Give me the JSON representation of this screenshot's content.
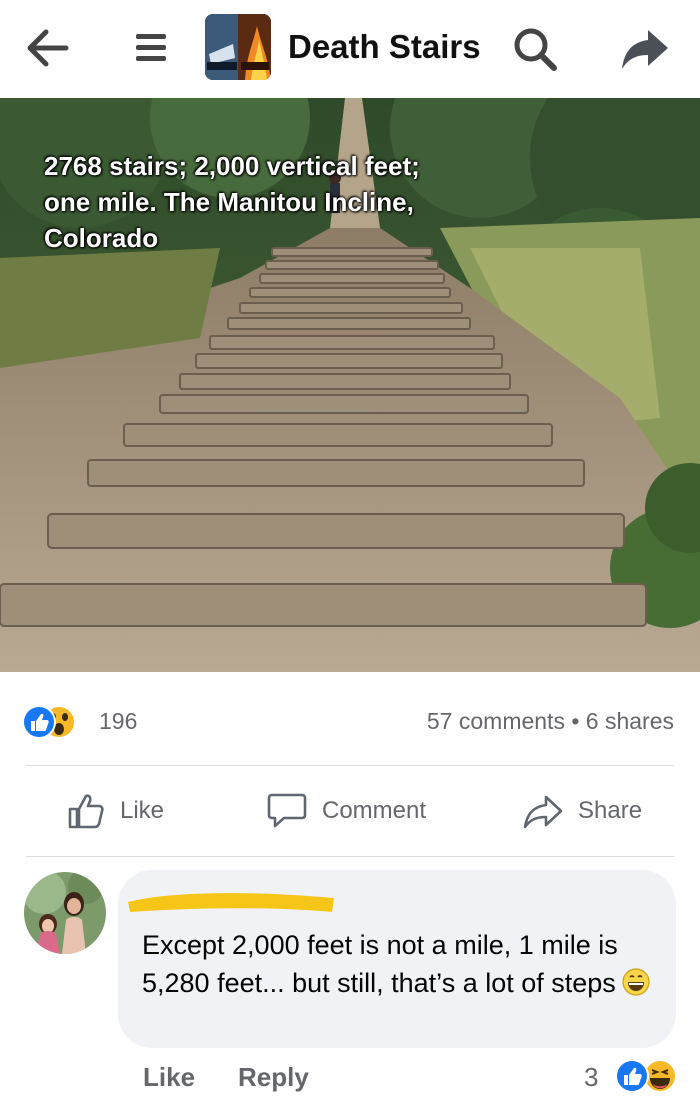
{
  "header": {
    "page_name": "Death Stairs",
    "icons": [
      "back-arrow-icon",
      "menu-icon",
      "search-icon",
      "share-arrow-icon"
    ]
  },
  "post": {
    "image_caption": "2768 stairs; 2,000 vertical feet;\none mile.  The Manitou Incline,\nColorado",
    "reaction_icons": [
      "like-icon",
      "wow-icon"
    ],
    "reaction_count": "196",
    "stats": "57 comments • 6 shares",
    "actions": {
      "like": "Like",
      "comment": "Comment",
      "share": "Share"
    }
  },
  "comment": {
    "text_before_emoji": "Except 2,000 feet is not a mile, 1 mile is 5,280 feet... but still, that’s a lot of steps",
    "emoji": "grinning-face-icon",
    "like_label": "Like",
    "reply_label": "Reply",
    "reaction_count": "3",
    "reaction_icons": [
      "like-icon",
      "haha-icon"
    ]
  },
  "colors": {
    "like_blue": "#1877f2",
    "wow_yellow": "#f7b928",
    "muted_text": "#65676b",
    "bubble_bg": "#f0f2f5",
    "redaction": "#f5c518"
  }
}
